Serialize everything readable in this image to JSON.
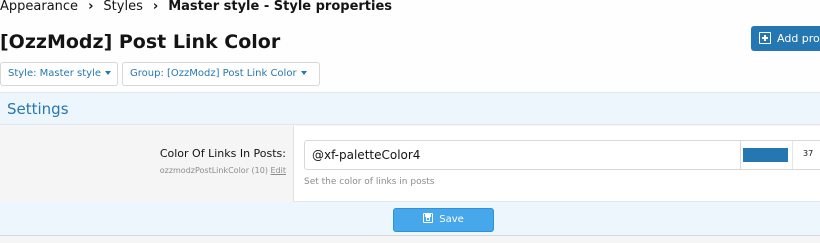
{
  "breadcrumb": {
    "items": [
      "Appearance",
      "Styles"
    ],
    "current": "Master style - Style properties"
  },
  "page": {
    "title": "[OzzModz] Post Link Color"
  },
  "header": {
    "add_button_label": "Add pro",
    "add_button_icon": "plus-square-icon"
  },
  "filters": {
    "style_label": "Style: Master style",
    "group_label": "Group: [OzzModz] Post Link Color"
  },
  "settings": {
    "heading": "Settings",
    "property": {
      "label": "Color Of Links In Posts:",
      "hint": "ozzmodzPostLinkColor (10)",
      "edit_link": "Edit",
      "value": "@xf-paletteColor4",
      "swatch_color": "#2577b1",
      "swatch_number": "37",
      "explain": "Set the color of links in posts"
    }
  },
  "footer": {
    "save_label": "Save",
    "save_icon": "save-icon"
  },
  "colors": {
    "accent": "#2577b1",
    "save_button": "#47a7eb",
    "header_bg": "#edf6fd"
  }
}
